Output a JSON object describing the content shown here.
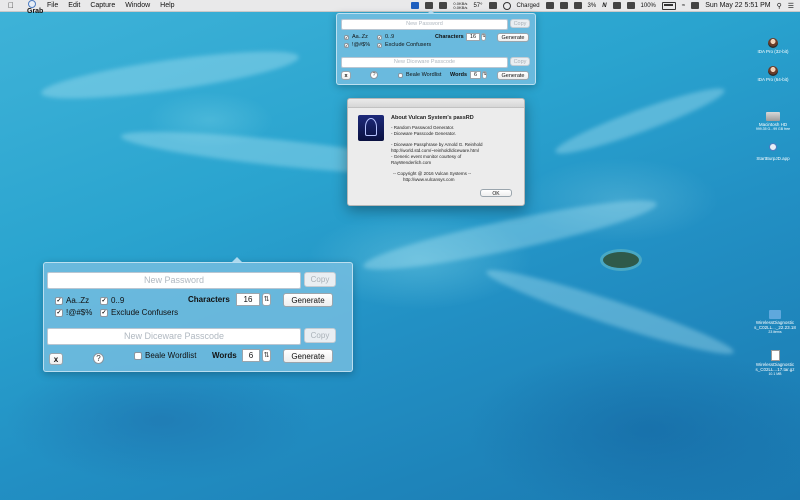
{
  "menubar": {
    "app_name": "Grab",
    "menus": [
      "File",
      "Edit",
      "Capture",
      "Window",
      "Help"
    ],
    "status": {
      "stats_top": "0.0KB/s",
      "stats_bottom": "0.0KB/s",
      "temp": "57°",
      "charging": "Charged",
      "percent_a": "3%",
      "battery": "100%",
      "clock": "Sun May 22  5:51 PM"
    }
  },
  "big_panel": {
    "password_placeholder": "New Password",
    "copy_label": "Copy",
    "opt_letters": "Aa..Zz",
    "opt_digits": "0..9",
    "opt_symbols": "!@#$%",
    "opt_confusers": "Exclude Confusers",
    "characters_label": "Characters",
    "characters_value": "16",
    "generate_label": "Generate",
    "diceware_placeholder": "New Diceware Passcode",
    "copy2_label": "Copy",
    "close_label": "x",
    "help_label": "?",
    "beale_label": "Beale Wordlist",
    "words_label": "Words",
    "words_value": "6",
    "generate2_label": "Generate"
  },
  "small_panel": {
    "password_placeholder": "New Password",
    "copy_label": "Copy",
    "opt_letters": "Aa..Zz",
    "opt_digits": "0..9",
    "opt_symbols": "!@#$%",
    "opt_confusers": "Exclude Confusers",
    "characters_label": "Characters",
    "characters_value": "16",
    "generate_label": "Generate",
    "diceware_placeholder": "New Diceware Passcode",
    "copy2_label": "Copy",
    "close_label": "x",
    "help_label": "?",
    "beale_label": "Beale Wordlist",
    "words_label": "Words",
    "words_value": "6",
    "generate2_label": "Generate"
  },
  "about": {
    "title": "About Vulcan System's passRD",
    "lines": [
      "- Random Password Generator.",
      "- Diceware Passcode Generator.",
      "- Diceware Passphrase by Arnold G. Reinhold",
      "  http://world.std.com/~reinhold/diceware.html",
      "- Generic event monitor courtesy of",
      "  RayWenderlich.com",
      "-- Copyright @ 2016 Vulcan Systems --",
      "http://www.vulcansys.com"
    ],
    "ok_label": "OK"
  },
  "desktop": {
    "icons": [
      {
        "name": "IDA Pro (32-bit)"
      },
      {
        "name": "IDA Pro (64-bit)"
      },
      {
        "name": "Macintosh HD",
        "sub": "999.35 G...99 GB free"
      },
      {
        "name": "StartBurpJD.app"
      },
      {
        "name": "WirelessDiagnostic",
        "name2": "s_C02LL..._22.23.18",
        "sub": "23 items"
      },
      {
        "name": "WirelessDiagnostic",
        "name2": "s_C02LL...17.tar.gz",
        "sub": "10.1 MB"
      }
    ]
  }
}
